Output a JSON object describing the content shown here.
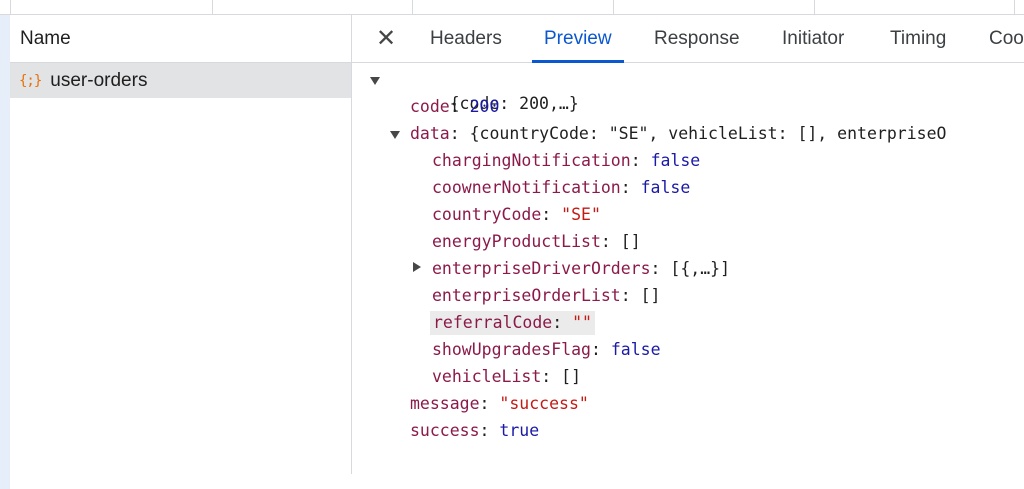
{
  "left_pane": {
    "column_header": "Name",
    "request": {
      "icon": "{;}",
      "name": "user-orders"
    }
  },
  "tabs": [
    "Headers",
    "Preview",
    "Response",
    "Initiator",
    "Timing",
    "Coo"
  ],
  "active_tab": "Preview",
  "preview": {
    "root_summary": "{code: 200,…}",
    "code": {
      "key": "code",
      "value": "200"
    },
    "data": {
      "key": "data",
      "summary": "{countryCode: \"SE\", vehicleList: [], enterpriseO",
      "fields": [
        {
          "key": "chargingNotification",
          "value": "false",
          "type": "bool"
        },
        {
          "key": "coownerNotification",
          "value": "false",
          "type": "bool"
        },
        {
          "key": "countryCode",
          "value": "\"SE\"",
          "type": "str"
        },
        {
          "key": "energyProductList",
          "value": "[]",
          "type": "punct"
        },
        {
          "key": "enterpriseDriverOrders",
          "value": "[{,…}]",
          "type": "punct",
          "collapsed": true
        },
        {
          "key": "enterpriseOrderList",
          "value": "[]",
          "type": "punct"
        },
        {
          "key": "referralCode",
          "value": "\"\"",
          "type": "str",
          "hovered": true
        },
        {
          "key": "showUpgradesFlag",
          "value": "false",
          "type": "bool"
        },
        {
          "key": "vehicleList",
          "value": "[]",
          "type": "punct"
        }
      ]
    },
    "message": {
      "key": "message",
      "value": "\"success\""
    },
    "success": {
      "key": "success",
      "value": "true"
    }
  },
  "colors": {
    "key": "#8b1a4a",
    "number": "#1a1aa6",
    "string": "#c41a16",
    "active_tab": "#0b57d0",
    "resource_icon": "#e8710a"
  },
  "icons": {
    "close": "close-icon",
    "expanded": "triangle-down-icon",
    "collapsed": "triangle-right-icon",
    "resource": "json-resource-icon"
  }
}
